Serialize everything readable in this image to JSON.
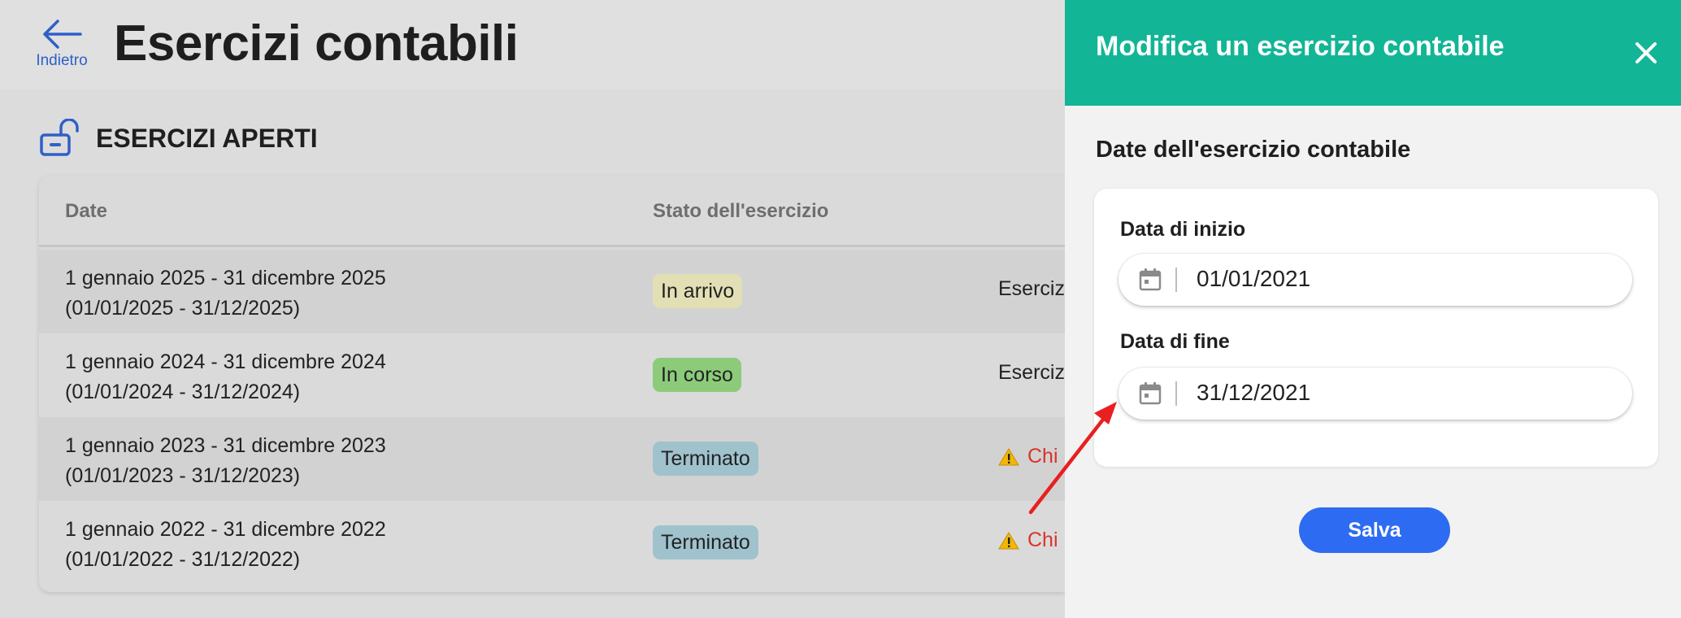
{
  "header": {
    "back_label": "Indietro",
    "title": "Esercizi contabili"
  },
  "section": {
    "title": "ESERCIZI APERTI"
  },
  "table": {
    "columns": [
      "Date",
      "Stato dell'esercizio"
    ],
    "rows": [
      {
        "date_line1": "1 gennaio 2025 - 31 dicembre 2025",
        "date_line2": "(01/01/2025 - 31/12/2025)",
        "status": "In arrivo",
        "status_color": "#e3dfb4",
        "action": "Eserciz",
        "action_warning": false
      },
      {
        "date_line1": "1 gennaio 2024 - 31 dicembre 2024",
        "date_line2": "(01/01/2024 - 31/12/2024)",
        "status": "In corso",
        "status_color": "#8ccb7a",
        "action": "Eserciz",
        "action_warning": false
      },
      {
        "date_line1": "1 gennaio 2023 - 31 dicembre 2023",
        "date_line2": "(01/01/2023 - 31/12/2023)",
        "status": "Terminato",
        "status_color": "#9fc2cd",
        "action": "Chi",
        "action_warning": true
      },
      {
        "date_line1": "1 gennaio 2022 - 31 dicembre 2022",
        "date_line2": "(01/01/2022 - 31/12/2022)",
        "status": "Terminato",
        "status_color": "#9fc2cd",
        "action": "Chi",
        "action_warning": true
      }
    ]
  },
  "drawer": {
    "title": "Modifica un esercizio contabile",
    "subtitle": "Date dell'esercizio contabile",
    "start_label": "Data di inizio",
    "start_value": "01/01/2021",
    "end_label": "Data di fine",
    "end_value": "31/12/2021",
    "save_label": "Salva"
  },
  "colors": {
    "accent_header": "#12b596",
    "primary_button": "#2d6cf2",
    "link_blue": "#2f5fc8",
    "warning_text": "#d9342b",
    "annotation_arrow": "#e8201f"
  },
  "icons": [
    "back-arrow-icon",
    "unlock-icon",
    "close-icon",
    "calendar-icon",
    "warning-icon"
  ]
}
